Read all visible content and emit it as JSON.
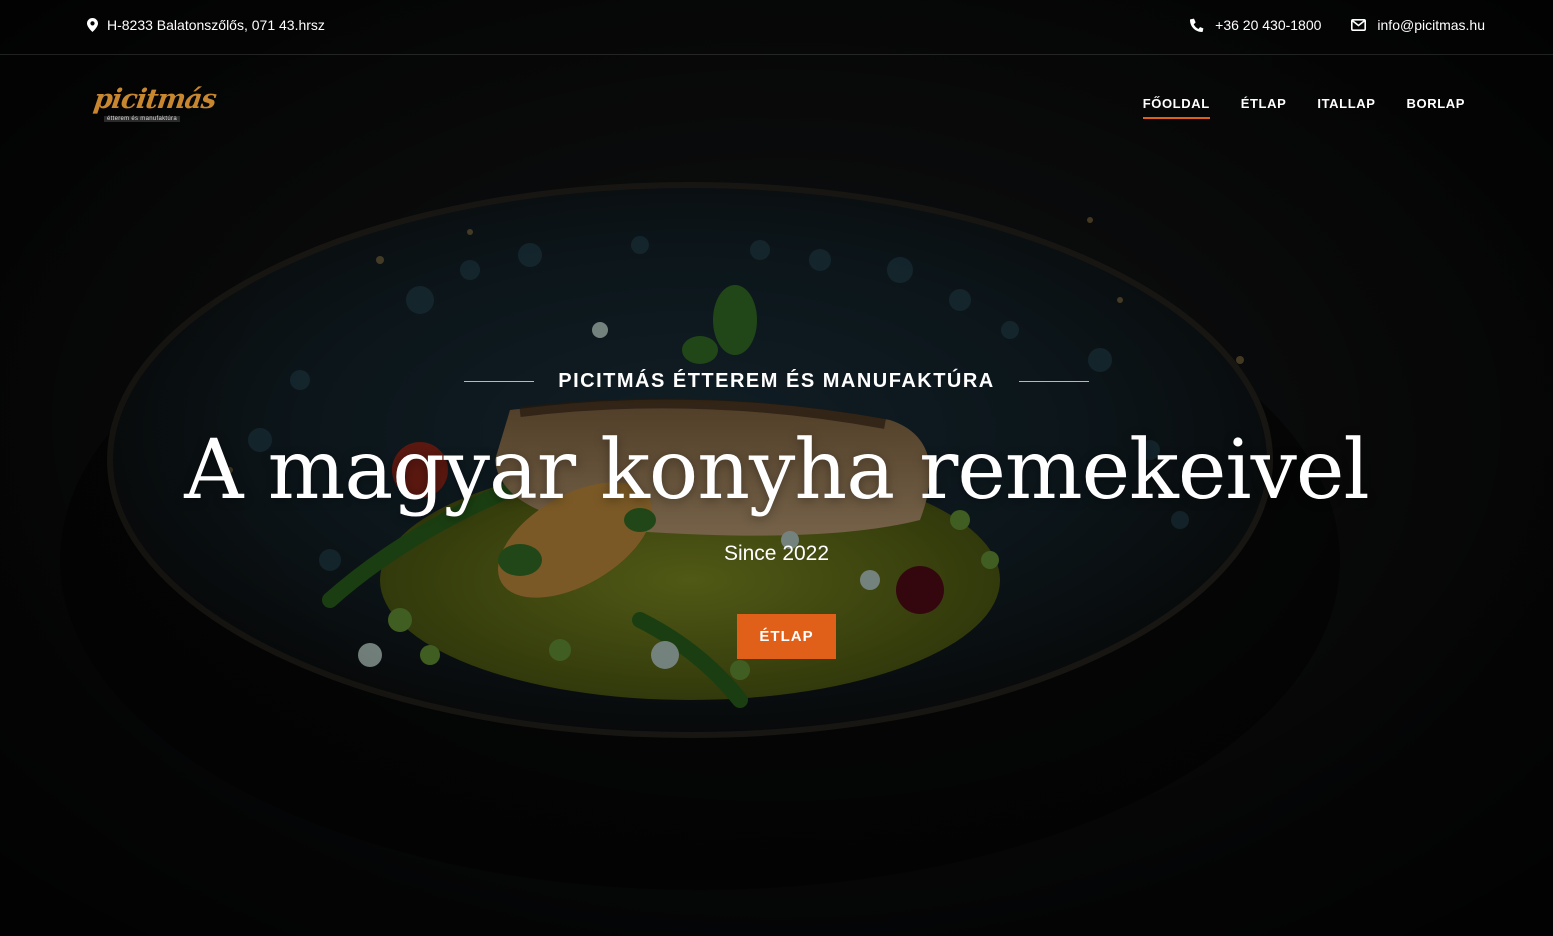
{
  "topbar": {
    "address": "H-8233 Balatonszőlős, 071 43.hrsz",
    "phone": "+36 20 430-1800",
    "email": "info@picitmas.hu"
  },
  "logo": {
    "text": "picitmás",
    "subtext": "étterem és manufaktúra"
  },
  "nav": {
    "items": [
      {
        "label": "FŐOLDAL",
        "active": true
      },
      {
        "label": "ÉTLAP",
        "active": false
      },
      {
        "label": "ITALLAP",
        "active": false
      },
      {
        "label": "BORLAP",
        "active": false
      }
    ]
  },
  "hero": {
    "tagline": "PICITMÁS ÉTTEREM ÉS MANUFAKTÚRA",
    "headline": "A magyar konyha remekeivel",
    "since": "Since 2022",
    "cta_label": "ÉTLAP"
  },
  "icons": {
    "address": "map-pin-icon",
    "phone": "phone-icon",
    "email": "envelope-icon"
  },
  "colors": {
    "accent": "#e0601a",
    "logo": "#c8872f",
    "background": "#0b0b0b"
  }
}
